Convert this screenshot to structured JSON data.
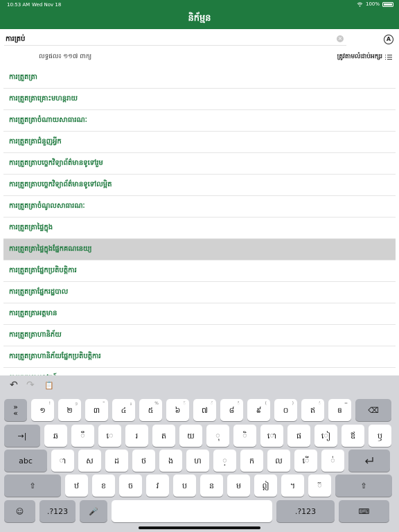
{
  "status_bar": {
    "time": "10:53 AM",
    "date": "Wed Nov 18",
    "battery": "100%"
  },
  "header": {
    "title": "និក័ម្មន"
  },
  "search": {
    "value": "ការត្រប់",
    "mode_label": "A"
  },
  "result": {
    "count": "លទ្ធផល៖ ១១៧ ពាក្យ",
    "sort_label": "ត្រូវតាមលំដាប់អក្សរ"
  },
  "words": [
    "ការត្រួតត្រា",
    "ការត្រួតត្រាគ្រោះមហន្តរាយ",
    "ការត្រួតត្រាចំណាយសាធារណៈ",
    "ការត្រួតត្រាជំនួញអ្វីក",
    "ការត្រួតត្រាបច្ចេកវិទ្យាព័ត៌មានទូទៅរួម",
    "ការត្រួតត្រាបច្ចេកវិទ្យាព័ត៌មានទូទៅលម្អិត",
    "ការត្រួតត្រាចំណូលសាធារណៈ",
    "ការត្រួតត្រាផ្ទៃក្នុង",
    "ការត្រួតត្រាផ្ទៃក្នុងផ្នែកគណនេយ្យ",
    "ការត្រួតត្រាផ្នែកប្រតិបត្តិការ",
    "ការត្រួតត្រាផ្នែករដ្ឋបាល",
    "ការត្រួតត្រាអត្តមាន",
    "ការត្រួតត្រាហានិភ័យ",
    "ការត្រួតត្រាហានិភ័យផ្នែកប្រតិបត្តិការ",
    "ការត្រួតត្រាអនុវត្តន៍"
  ],
  "selected_index": 8,
  "keyboard": {
    "toolbar": {
      "undo": "↶",
      "redo": "↷",
      "paste": "📋"
    },
    "row1": [
      "»\n«",
      "១",
      "២",
      "៣",
      "៤",
      "៥",
      "៦",
      "៧",
      "៨",
      "៩",
      "០",
      "ឥ",
      "ឲ",
      "⌫"
    ],
    "row1_sub": [
      "",
      "!",
      "ៗ",
      "\"",
      "៛",
      "%",
      "៍",
      "័",
      "៏",
      "(",
      ")",
      "៌",
      "=",
      ""
    ],
    "row2": [
      "→|",
      "ឆ",
      "ឹ",
      "េ",
      "រ",
      "ត",
      "យ",
      "ុ",
      "ិ",
      "ោ",
      "ផ",
      "ៀ",
      "ឪ",
      "ឫ"
    ],
    "row3": [
      "abc",
      "ា",
      "ស",
      "ដ",
      "ថ",
      "ង",
      "ហ",
      "្",
      "ក",
      "ល",
      "ើ",
      "់",
      "return-icon"
    ],
    "row4": [
      "⇧",
      "ឋ",
      "ខ",
      "ច",
      "វ",
      "ប",
      "ន",
      "ម",
      "ឦ",
      "។",
      "៊",
      "⇧"
    ],
    "row5": [
      "☺",
      ".?123",
      "🎤",
      "",
      ".?123",
      "⌨"
    ]
  }
}
